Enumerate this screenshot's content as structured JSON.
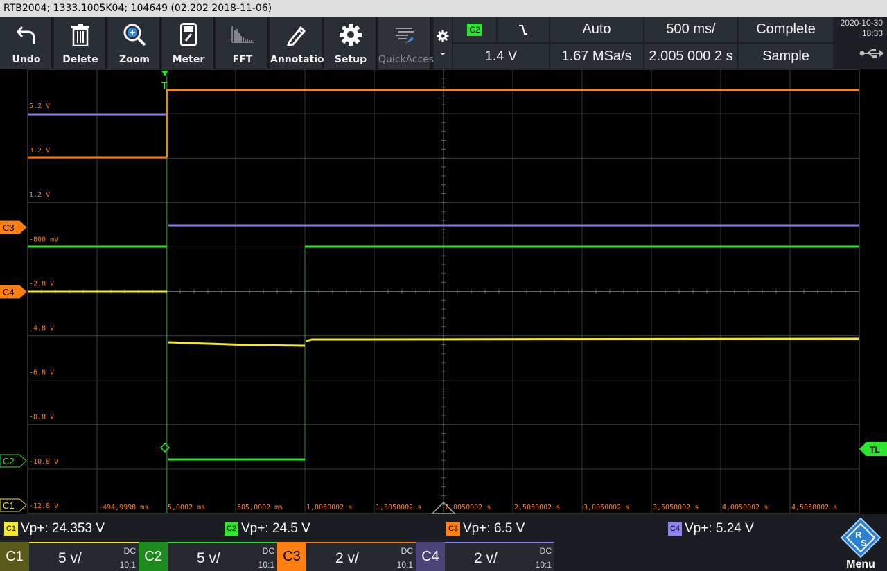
{
  "title": "RTB2004; 1333.1005K04; 104649 (02.202 2018-11-06)",
  "toolbar": {
    "undo": "Undo",
    "delete": "Delete",
    "zoom": "Zoom",
    "meter": "Meter",
    "fft": "FFT",
    "annotation": "Annotation",
    "setup": "Setup",
    "quickaccess": "QuickAccess"
  },
  "trigger": {
    "source": "C2",
    "slope_icon": "falling-edge-icon",
    "mode": "Auto",
    "timebase": "500 ms/",
    "status": "Complete",
    "level": "1.4 V",
    "sample_rate": "1.67 MSa/s",
    "position": "2.005 000 2 s",
    "acquisition": "Sample"
  },
  "datetime": {
    "date": "2020-10-30",
    "time": "18:33"
  },
  "colors": {
    "c1": "#f5e72a",
    "c2": "#2ce52c",
    "c3": "#ff7f11",
    "c4": "#8c82f0",
    "grid": "#3a3a3a"
  },
  "volt_labels": [
    "5.2 V",
    "3.2 V",
    "1.2 V",
    "-800 mV",
    "-2.8 V",
    "-4.8 V",
    "-6.8 V",
    "-8.8 V",
    "-10.8 V",
    "-12.8 V"
  ],
  "time_labels": [
    "-494,9998 ms",
    "5,0002 ms",
    "505,0002 ms",
    "1,0050002 s",
    "1,5050002 s",
    "2,0050002 s",
    "2,5050002 s",
    "3,0050002 s",
    "3,5050002 s",
    "4,0050002 s",
    "4,5050002 s"
  ],
  "markers": {
    "trigger": "T",
    "trigger_level": "TL",
    "c2": "C2",
    "c1": "C1",
    "c3c4": "C3",
    "c4c1": "C4"
  },
  "measurements": [
    {
      "chip": "C1",
      "text": "Vp+: 24.353 V"
    },
    {
      "chip": "C2",
      "text": "Vp+: 24.5 V"
    },
    {
      "chip": "C3",
      "text": "Vp+: 6.5 V"
    },
    {
      "chip": "C4",
      "text": "Vp+: 5.24 V"
    }
  ],
  "channels": [
    {
      "name": "C1",
      "scale": "5 v/",
      "coupling": "DC",
      "probe": "10:1"
    },
    {
      "name": "C2",
      "scale": "5 v/",
      "coupling": "DC",
      "probe": "10:1"
    },
    {
      "name": "C3",
      "scale": "2 v/",
      "coupling": "DC",
      "probe": "10:1"
    },
    {
      "name": "C4",
      "scale": "2 v/",
      "coupling": "DC",
      "probe": "10:1"
    }
  ],
  "menu": "Menu"
}
